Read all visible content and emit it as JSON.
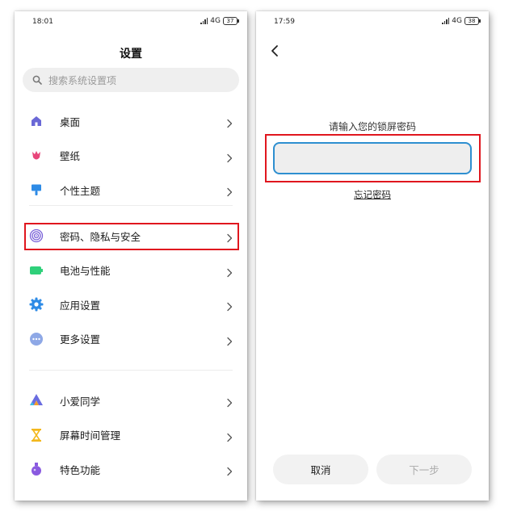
{
  "left_screen": {
    "status": {
      "time": "18:01",
      "network": "4G",
      "battery": "37"
    },
    "title": "设置",
    "search": {
      "placeholder": "搜索系统设置项",
      "icon": "search-icon"
    },
    "groups": [
      [
        {
          "label": "桌面",
          "icon": "home-icon",
          "color": "#6a68d6"
        },
        {
          "label": "壁纸",
          "icon": "tulip-icon",
          "color": "#e8457a"
        },
        {
          "label": "个性主题",
          "icon": "paint-brush-icon",
          "color": "#2e8be6"
        }
      ],
      [
        {
          "label": "密码、隐私与安全",
          "icon": "fingerprint-icon",
          "color": "#7b63d8",
          "highlighted": true
        },
        {
          "label": "电池与性能",
          "icon": "battery-icon",
          "color": "#2fd07a"
        },
        {
          "label": "应用设置",
          "icon": "gear-icon",
          "color": "#2e8be6"
        },
        {
          "label": "更多设置",
          "icon": "more-dots-icon",
          "color": "#8ea8e6"
        }
      ],
      [
        {
          "label": "小爱同学",
          "icon": "xiaoai-icon",
          "color": "#6a6ce0"
        },
        {
          "label": "屏幕时间管理",
          "icon": "hourglass-icon",
          "color": "#f3b81f"
        },
        {
          "label": "特色功能",
          "icon": "potion-icon",
          "color": "#8a5ae0"
        }
      ]
    ]
  },
  "right_screen": {
    "status": {
      "time": "17:59",
      "network": "4G",
      "battery": "38"
    },
    "back_icon": "back-arrow-icon",
    "prompt": "请输入您的锁屏密码",
    "password_value": "",
    "forgot_link": "忘记密码",
    "cancel_button": "取消",
    "next_button": "下一步"
  },
  "highlight_color": "#e0161e",
  "accent_color": "#2e8fd0"
}
